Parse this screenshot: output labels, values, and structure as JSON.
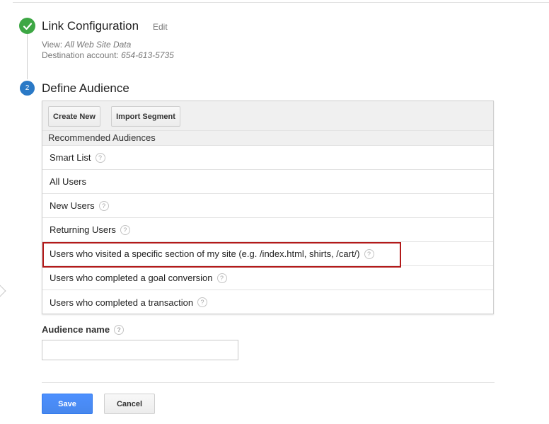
{
  "colors": {
    "check_green": "#3da744",
    "step_blue": "#2a79c6",
    "highlight_red": "#b21a1a",
    "save_blue": "#4d90fe"
  },
  "step1": {
    "icon": "checkmark-icon",
    "title": "Link Configuration",
    "edit_label": "Edit",
    "view_label": "View:",
    "view_value": "All Web Site Data",
    "destination_label": "Destination account:",
    "destination_value": "654-613-5735"
  },
  "step2": {
    "number": "2",
    "title": "Define Audience",
    "toolbar": {
      "create_new": "Create New",
      "import_segment": "Import Segment"
    },
    "section_header": "Recommended Audiences",
    "help_glyph": "?",
    "audiences": [
      {
        "label": "Smart List",
        "help": true
      },
      {
        "label": "All Users",
        "help": false
      },
      {
        "label": "New Users",
        "help": true
      },
      {
        "label": "Returning Users",
        "help": true
      },
      {
        "label": "Users who visited a specific section of my site (e.g. /index.html, shirts, /cart/)",
        "help": true,
        "highlighted": true
      },
      {
        "label": "Users who completed a goal conversion",
        "help": true
      },
      {
        "label": "Users who completed a transaction",
        "help": true
      }
    ]
  },
  "audience_name": {
    "label": "Audience name",
    "value": ""
  },
  "actions": {
    "save_label": "Save",
    "cancel_label": "Cancel"
  }
}
